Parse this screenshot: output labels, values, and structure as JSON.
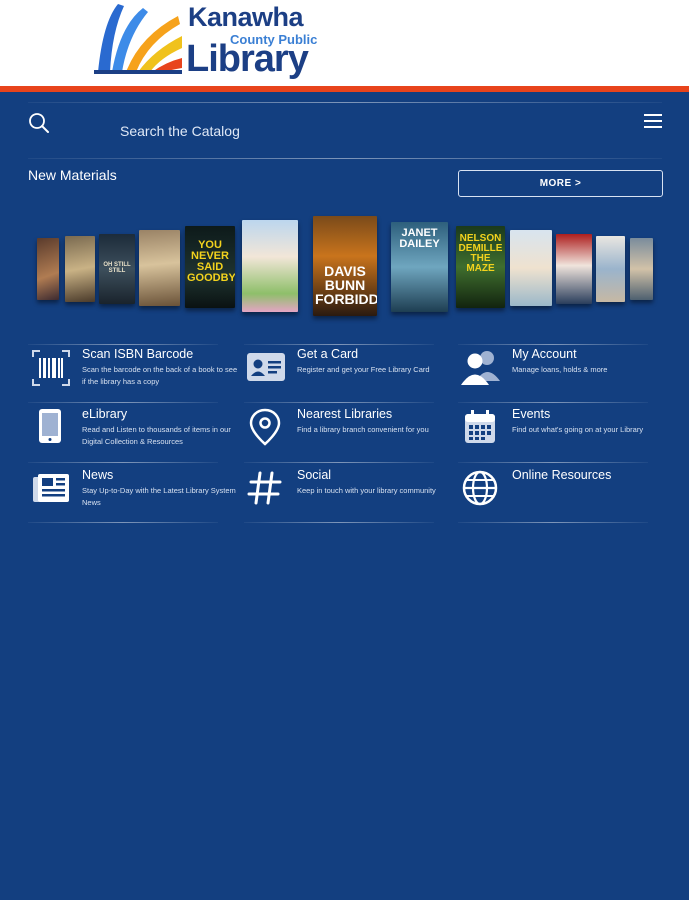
{
  "brand": {
    "name_line1": "Kanawha",
    "name_line2": "County Public",
    "name_line3": "Library",
    "colors": {
      "navy": "#1c3f85",
      "accent": "#e8441c",
      "panel": "#133f80"
    }
  },
  "search": {
    "placeholder": "Search the Catalog"
  },
  "new_materials": {
    "title": "New Materials",
    "more_label": "MORE >"
  },
  "books": [
    {
      "text": ""
    },
    {
      "text": ""
    },
    {
      "text": "OH STILL STILL"
    },
    {
      "text": ""
    },
    {
      "text": "YOU NEVER SAID GOODBYE"
    },
    {
      "text": ""
    },
    {
      "text": "DAVIS BUNN FORBIDDEN"
    },
    {
      "text": "JANET DAILEY"
    },
    {
      "text": "NELSON DEMILLE THE MAZE"
    },
    {
      "text": ""
    },
    {
      "text": ""
    },
    {
      "text": ""
    },
    {
      "text": ""
    }
  ],
  "tiles": [
    {
      "title": "Scan ISBN Barcode",
      "desc": "Scan the barcode on the back of a book to see if the library has a copy",
      "icon": "barcode-icon"
    },
    {
      "title": "Get a Card",
      "desc": "Register and get your Free Library Card",
      "icon": "id-card-icon"
    },
    {
      "title": "My Account",
      "desc": "Manage loans, holds & more",
      "icon": "users-icon"
    },
    {
      "title": "eLibrary",
      "desc": "Read and Listen to thousands of items in our Digital Collection & Resources",
      "icon": "tablet-icon"
    },
    {
      "title": "Nearest Libraries",
      "desc": "Find a library branch convenient for you",
      "icon": "location-pin-icon"
    },
    {
      "title": "Events",
      "desc": "Find out what's going on at your Library",
      "icon": "calendar-icon"
    },
    {
      "title": "News",
      "desc": "Stay Up-to-Day with the Latest Library System News",
      "icon": "newspaper-icon"
    },
    {
      "title": "Social",
      "desc": "Keep in touch with your library community",
      "icon": "hashtag-icon"
    },
    {
      "title": "Online Resources",
      "desc": "",
      "icon": "globe-icon"
    }
  ]
}
